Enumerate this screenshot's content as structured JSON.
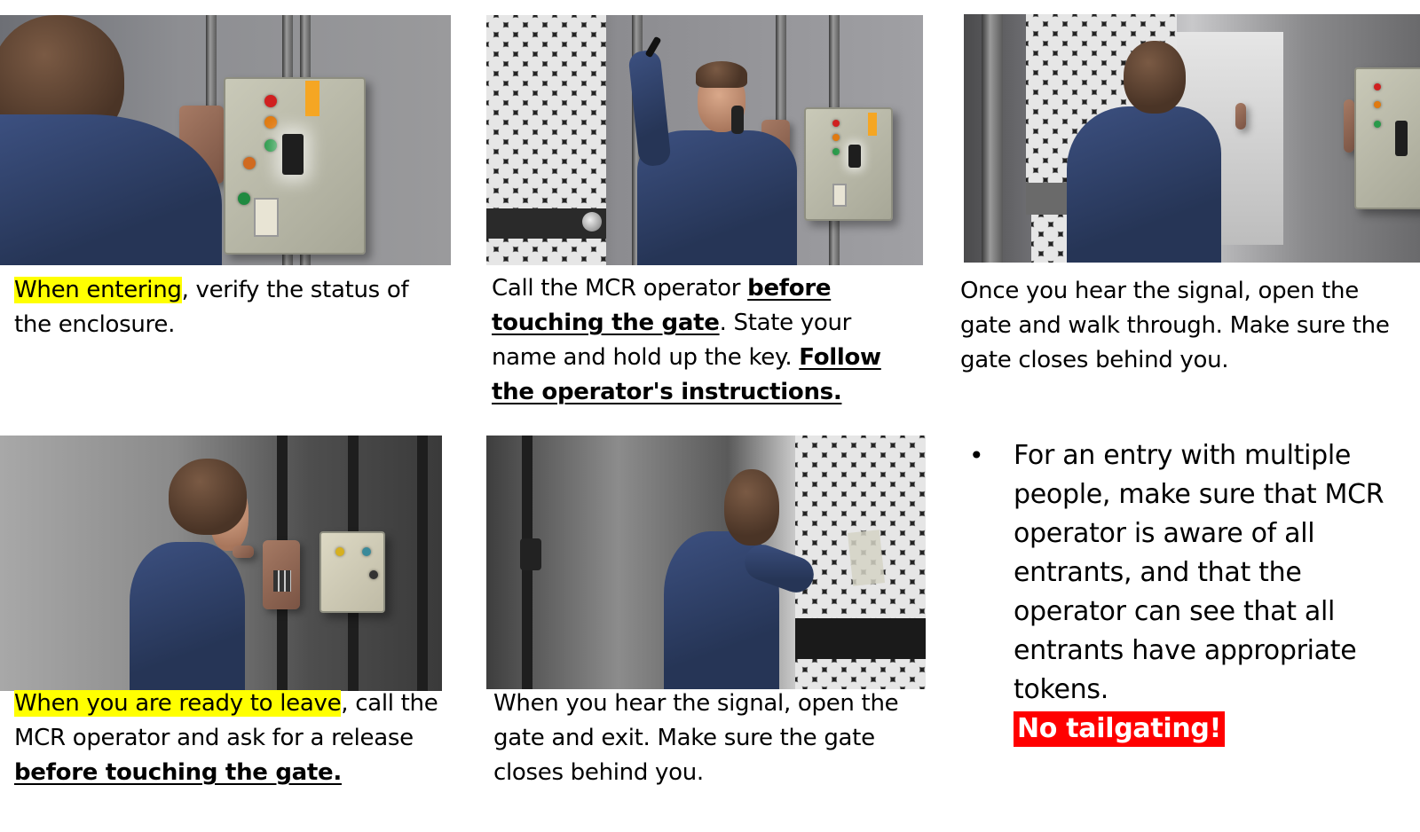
{
  "slide": {
    "steps": [
      {
        "id": "step-1-verify-enclosure",
        "image_icon": "person-facing-enclosure-panel",
        "caption": {
          "highlight": "When entering",
          "rest": ", verify the status of the enclosure."
        }
      },
      {
        "id": "step-2-call-operator",
        "image_icon": "person-on-phone-holding-key",
        "caption": {
          "text_1": "Call the MCR operator ",
          "bold_1": "before touching the gate",
          "text_2": ". State your name and hold up the key.  ",
          "bold_2": "Follow the operator's instructions."
        }
      },
      {
        "id": "step-3-walk-through",
        "image_icon": "person-walking-through-gate",
        "caption": {
          "text": "Once you hear the signal, open the gate and walk through. Make sure the gate closes behind you."
        }
      },
      {
        "id": "step-4-ready-to-leave",
        "image_icon": "person-calling-on-wall-phone",
        "caption": {
          "highlight": "When you are ready to leave",
          "text_1": ", call the MCR operator and ask for a release ",
          "bold_1": "before touching the gate."
        }
      },
      {
        "id": "step-5-exit",
        "image_icon": "person-opening-mesh-gate",
        "caption": {
          "text": "When you hear the signal, open the gate and exit.  Make sure the gate closes behind you."
        }
      }
    ],
    "note": {
      "bullet": "•",
      "text": "For an entry with multiple people, make sure that MCR operator is aware of all entrants, and that the operator can see that all entrants have appropriate tokens.",
      "warning": "No tailgating!"
    },
    "colors": {
      "highlight": "#ffff00",
      "warning_bg": "#ff0000",
      "warning_text": "#ffffff",
      "text": "#000000"
    }
  }
}
